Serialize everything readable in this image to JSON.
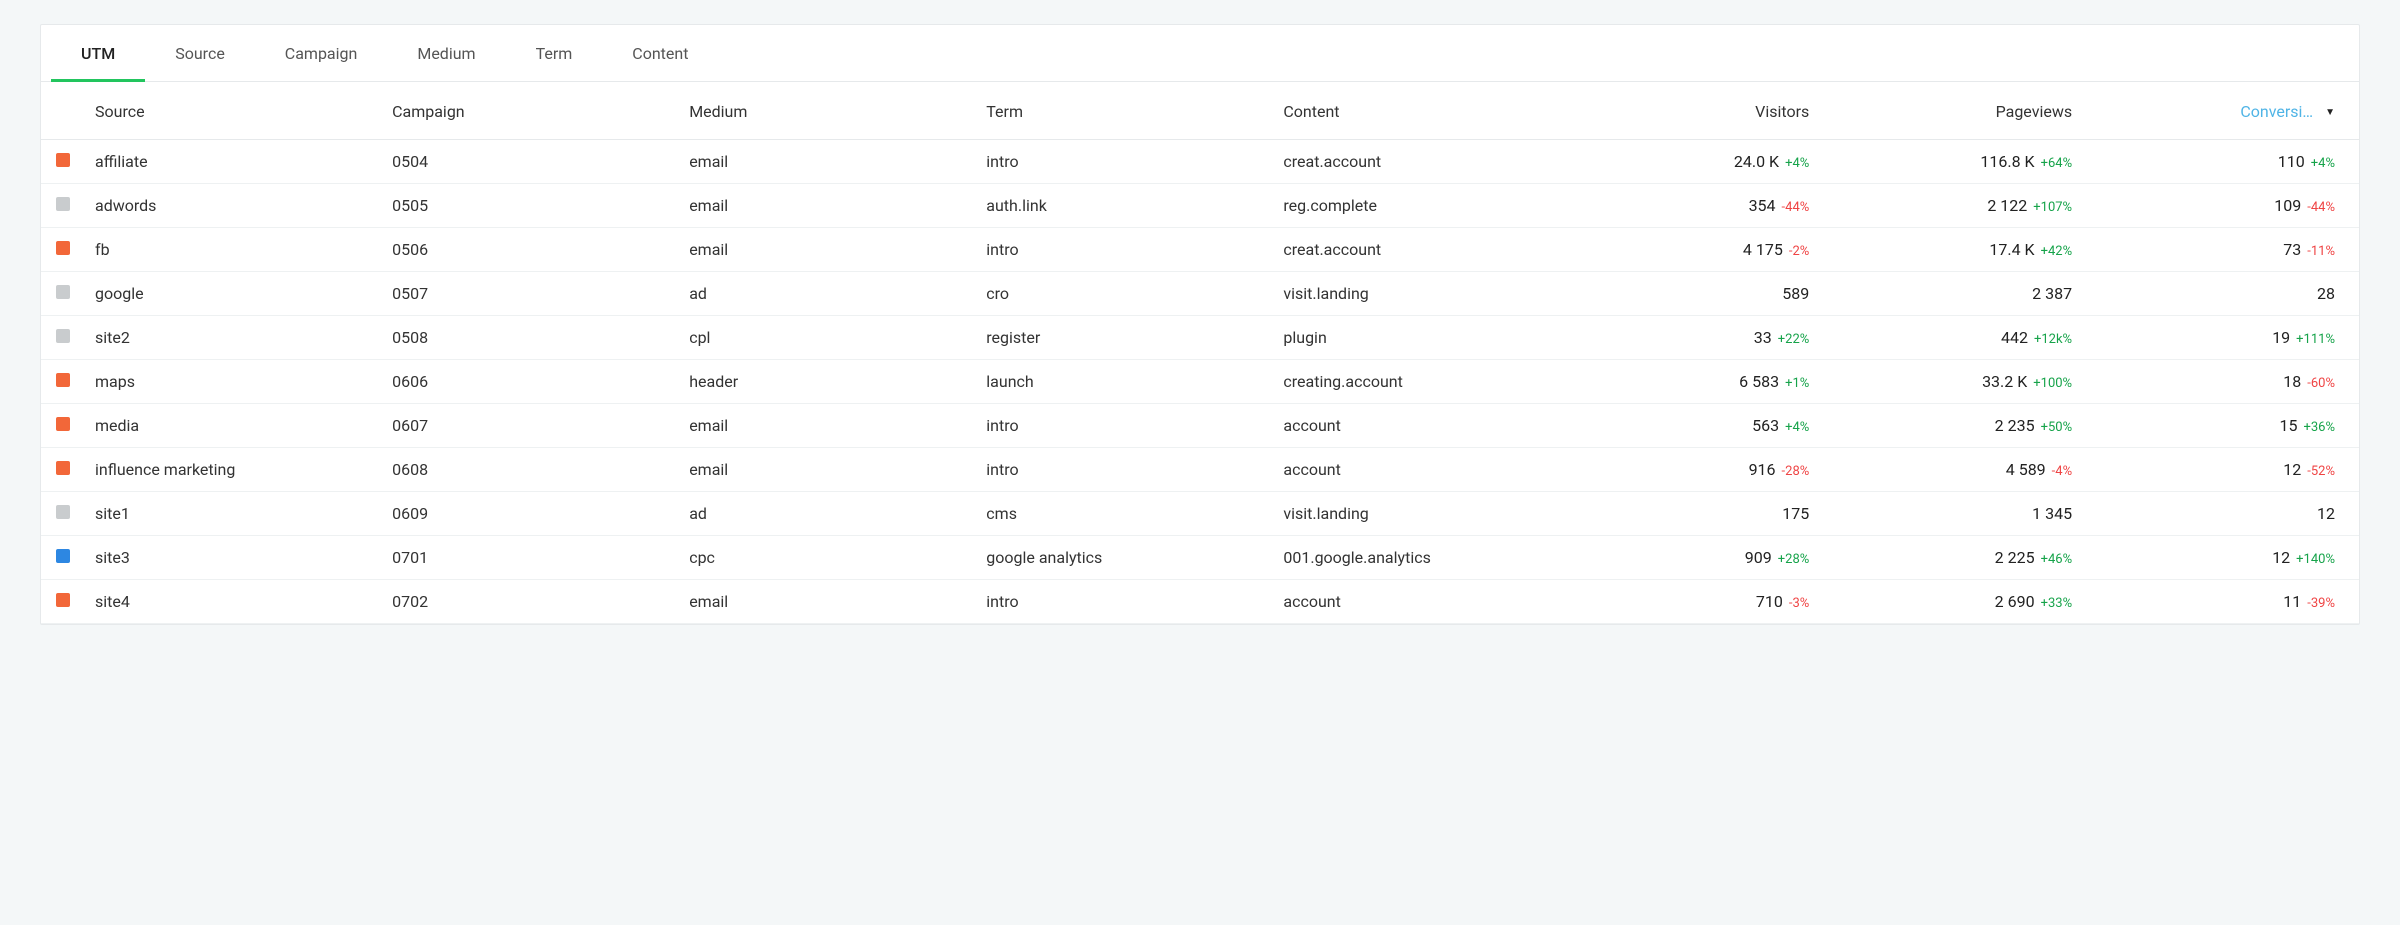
{
  "tabs": [
    {
      "label": "UTM",
      "active": true
    },
    {
      "label": "Source",
      "active": false
    },
    {
      "label": "Campaign",
      "active": false
    },
    {
      "label": "Medium",
      "active": false
    },
    {
      "label": "Term",
      "active": false
    },
    {
      "label": "Content",
      "active": false
    }
  ],
  "columns": {
    "source": "Source",
    "campaign": "Campaign",
    "medium": "Medium",
    "term": "Term",
    "content": "Content",
    "visitors": "Visitors",
    "pageviews": "Pageviews",
    "conversions": "Conversi…"
  },
  "sort": {
    "column": "conversions",
    "direction": "desc"
  },
  "swatch_colors": {
    "orange": "#f26739",
    "grey": "#c9ccce",
    "blue": "#2d87e2"
  },
  "rows": [
    {
      "swatch": "orange",
      "source": "affiliate",
      "campaign": "0504",
      "medium": "email",
      "term": "intro",
      "content": "creat.account",
      "visitors": {
        "value": "24.0 K",
        "delta": "+4%",
        "sign": "pos"
      },
      "pageviews": {
        "value": "116.8 K",
        "delta": "+64%",
        "sign": "pos"
      },
      "conversions": {
        "value": "110",
        "delta": "+4%",
        "sign": "pos"
      }
    },
    {
      "swatch": "grey",
      "source": "adwords",
      "campaign": "0505",
      "medium": "email",
      "term": "auth.link",
      "content": "reg.complete",
      "visitors": {
        "value": "354",
        "delta": "-44%",
        "sign": "neg"
      },
      "pageviews": {
        "value": "2 122",
        "delta": "+107%",
        "sign": "pos"
      },
      "conversions": {
        "value": "109",
        "delta": "-44%",
        "sign": "neg"
      }
    },
    {
      "swatch": "orange",
      "source": "fb",
      "campaign": "0506",
      "medium": "email",
      "term": "intro",
      "content": "creat.account",
      "visitors": {
        "value": "4 175",
        "delta": "-2%",
        "sign": "neg"
      },
      "pageviews": {
        "value": "17.4 K",
        "delta": "+42%",
        "sign": "pos"
      },
      "conversions": {
        "value": "73",
        "delta": "-11%",
        "sign": "neg"
      }
    },
    {
      "swatch": "grey",
      "source": "google",
      "campaign": "0507",
      "medium": "ad",
      "term": "cro",
      "content": "visit.landing",
      "visitors": {
        "value": "589",
        "delta": "",
        "sign": ""
      },
      "pageviews": {
        "value": "2 387",
        "delta": "",
        "sign": ""
      },
      "conversions": {
        "value": "28",
        "delta": "",
        "sign": ""
      }
    },
    {
      "swatch": "grey",
      "source": "site2",
      "campaign": "0508",
      "medium": "cpl",
      "term": "register",
      "content": "plugin",
      "visitors": {
        "value": "33",
        "delta": "+22%",
        "sign": "pos"
      },
      "pageviews": {
        "value": "442",
        "delta": "+12k%",
        "sign": "pos"
      },
      "conversions": {
        "value": "19",
        "delta": "+111%",
        "sign": "pos"
      }
    },
    {
      "swatch": "orange",
      "source": "maps",
      "campaign": "0606",
      "medium": "header",
      "term": "launch",
      "content": "creating.account",
      "visitors": {
        "value": "6 583",
        "delta": "+1%",
        "sign": "pos"
      },
      "pageviews": {
        "value": "33.2 K",
        "delta": "+100%",
        "sign": "pos"
      },
      "conversions": {
        "value": "18",
        "delta": "-60%",
        "sign": "neg"
      }
    },
    {
      "swatch": "orange",
      "source": "media",
      "campaign": "0607",
      "medium": "email",
      "term": "intro",
      "content": "account",
      "visitors": {
        "value": "563",
        "delta": "+4%",
        "sign": "pos"
      },
      "pageviews": {
        "value": "2 235",
        "delta": "+50%",
        "sign": "pos"
      },
      "conversions": {
        "value": "15",
        "delta": "+36%",
        "sign": "pos"
      }
    },
    {
      "swatch": "orange",
      "source": "influence marketing",
      "campaign": "0608",
      "medium": "email",
      "term": "intro",
      "content": "account",
      "visitors": {
        "value": "916",
        "delta": "-28%",
        "sign": "neg"
      },
      "pageviews": {
        "value": "4 589",
        "delta": "-4%",
        "sign": "neg"
      },
      "conversions": {
        "value": "12",
        "delta": "-52%",
        "sign": "neg"
      }
    },
    {
      "swatch": "grey",
      "source": "site1",
      "campaign": "0609",
      "medium": "ad",
      "term": "cms",
      "content": "visit.landing",
      "visitors": {
        "value": "175",
        "delta": "",
        "sign": ""
      },
      "pageviews": {
        "value": "1 345",
        "delta": "",
        "sign": ""
      },
      "conversions": {
        "value": "12",
        "delta": "",
        "sign": ""
      }
    },
    {
      "swatch": "blue",
      "source": "site3",
      "campaign": "0701",
      "medium": "cpc",
      "term": "google analytics",
      "content": "001.google.analytics",
      "visitors": {
        "value": "909",
        "delta": "+28%",
        "sign": "pos"
      },
      "pageviews": {
        "value": "2 225",
        "delta": "+46%",
        "sign": "pos"
      },
      "conversions": {
        "value": "12",
        "delta": "+140%",
        "sign": "pos"
      }
    },
    {
      "swatch": "orange",
      "source": "site4",
      "campaign": "0702",
      "medium": "email",
      "term": "intro",
      "content": "account",
      "visitors": {
        "value": "710",
        "delta": "-3%",
        "sign": "neg"
      },
      "pageviews": {
        "value": "2 690",
        "delta": "+33%",
        "sign": "pos"
      },
      "conversions": {
        "value": "11",
        "delta": "-39%",
        "sign": "neg"
      }
    }
  ]
}
